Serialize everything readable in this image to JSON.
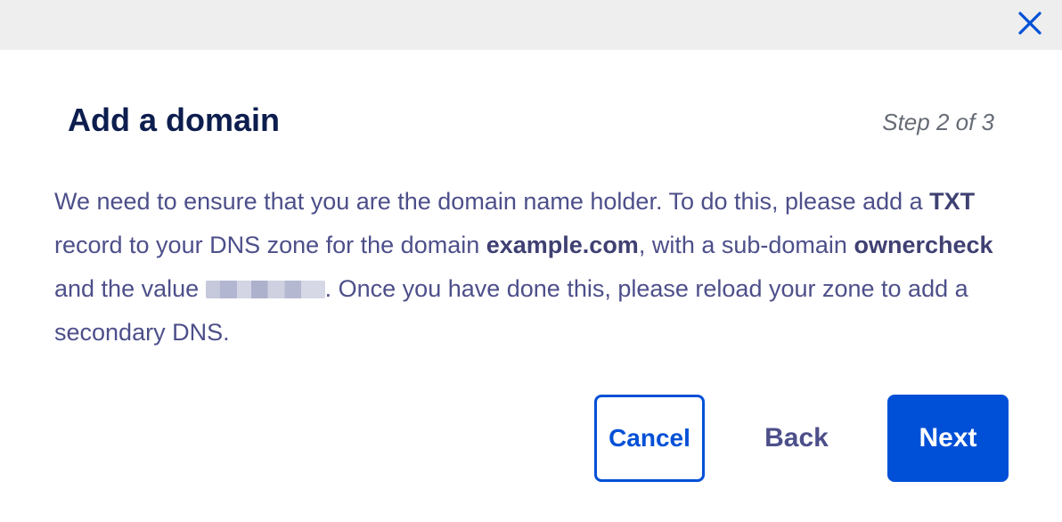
{
  "dialog": {
    "title": "Add a domain",
    "step": "Step 2 of 3",
    "message": {
      "p1": "We need to ensure that you are the domain name holder. To do this, please add a ",
      "record_type": "TXT",
      "p2": " record to your DNS zone for the domain ",
      "domain": "example.com",
      "p3": ", with a sub-domain ",
      "subdomain": "ownercheck",
      "p4": " and the value ",
      "p5": ". Once you have done this, please reload your zone to add a secondary DNS."
    },
    "buttons": {
      "cancel": "Cancel",
      "back": "Back",
      "next": "Next"
    }
  },
  "colors": {
    "primary": "#0050d7",
    "title": "#0c1d4e",
    "body_text": "#4d4f8a",
    "topbar": "#eeeeee"
  },
  "icons": {
    "close": "close-icon"
  }
}
